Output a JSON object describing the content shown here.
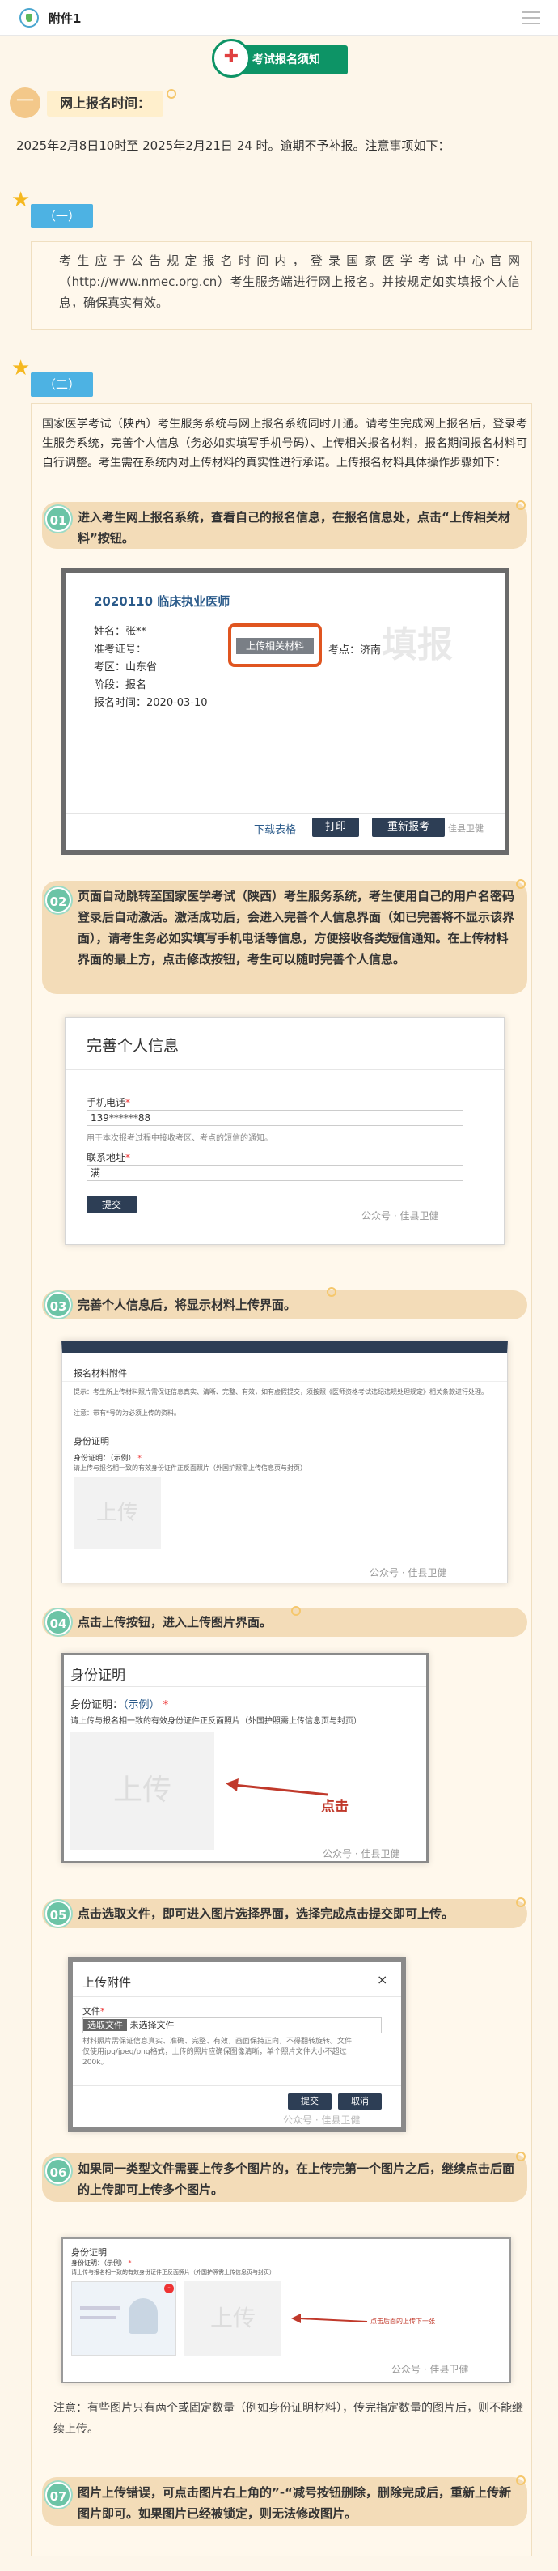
{
  "header": {
    "title": "附件1"
  },
  "banner": {
    "title": "考试报名须知"
  },
  "online_time": {
    "label": "网上报名时间：",
    "text": "2025年2月8日10时至 2025年2月21日 24 时。逾期不予补报。注意事项如下："
  },
  "section1": {
    "tag": "（一）",
    "text": "考生应于公告规定报名时间内，登录国家医学考试中心官网（http://www.nmec.org.cn）考生服务端进行网上报名。并按规定如实填报个人信息，确保真实有效。"
  },
  "section2": {
    "tag": "（二）",
    "text": "国家医学考试（陕西）考生服务系统与网上报名系统同时开通。请考生完成网上报名后，登录考生服务系统，完善个人信息（务必如实填写手机号码）、上传相关报名材料，报名期间报名材料可自行调整。考生需在系统内对上传材料的真实性进行承诺。上传报名材料具体操作步骤如下："
  },
  "steps": [
    {
      "num": "01",
      "text": "进入考生网上报名系统，查看自己的报名信息，在报名信息处，点击“上传相关材料”按钮。"
    },
    {
      "num": "02",
      "text": "页面自动跳转至国家医学考试（陕西）考生服务系统，考生使用自己的用户名密码登录后自动激活。激活成功后，会进入完善个人信息界面（如已完善将不显示该界面），请考生务必如实填写手机电话等信息，方便接收各类短信通知。在上传材料界面的最上方，点击修改按钮，考生可以随时完善个人信息。"
    },
    {
      "num": "03",
      "text": "完善个人信息后，将显示材料上传界面。"
    },
    {
      "num": "04",
      "text": "点击上传按钮，进入上传图片界面。"
    },
    {
      "num": "05",
      "text": "点击选取文件，即可进入图片选择界面，选择完成点击提交即可上传。"
    },
    {
      "num": "06",
      "text": "如果同一类型文件需要上传多个图片的，在上传完第一个图片之后，继续点击后面的上传即可上传多个图片。"
    },
    {
      "num": "07",
      "text": "图片上传错误，可点击图片右上角的”-“减号按钮删除，删除完成后，重新上传新图片即可。如果图片已经被锁定，则无法修改图片。"
    }
  ],
  "step6_note": "注意：有些图片只有两个或固定数量（例如身份证明材料），传完指定数量的图片后，则不能继续上传。",
  "shot1": {
    "title": "2020110 临床执业医师",
    "name_label": "姓名：",
    "name_value": "张**",
    "id_label": "准考证号：",
    "area_label": "考区：",
    "area_value": "山东省",
    "upload_btn": "上传相关材料",
    "kaodian_label": "考点：",
    "kaodian_value": "济南",
    "stage_label": "阶段：",
    "stage_value": "报名",
    "time_label": "报名时间：",
    "time_value": "2020-03-10",
    "stamp": "填报",
    "download": "下载表格",
    "print": "打印",
    "reapply": "重新报考",
    "watermark": "佳县卫健"
  },
  "shot2": {
    "title": "完善个人信息",
    "phone_label": "手机电话",
    "phone_value": "139******88",
    "phone_hint": "用于本次报考过程中接收考区、考点的短信的通知。",
    "addr_label": "联系地址",
    "addr_value": "满",
    "submit": "提交",
    "watermark": "公众号 · 佳县卫健"
  },
  "shot3": {
    "section": "报名材料附件",
    "hint": "提示：考生所上传材料照片需保证信息真实、清晰、完整、有效，如有虚假提交，须按照《医师资格考试违纪违规处理规定》相关条款进行处理。",
    "hint2": "注意：带有*号的为必须上传的资料。",
    "id_title": "身份证明",
    "id_label": "身份证明：（示例）",
    "id_desc": "请上传与报名相一致的有效身份证件正反面照片（外国护照需上传信息页与封页）",
    "upload": "上传",
    "watermark": "公众号 · 佳县卫健"
  },
  "shot4": {
    "title": "身份证明",
    "label": "身份证明：",
    "example": "（示例）",
    "desc": "请上传与报名相一致的有效身份证件正反面照片（外国护照需上传信息页与封页）",
    "upload": "上传",
    "click": "点击",
    "watermark": "公众号 · 佳县卫健"
  },
  "shot5": {
    "title": "上传附件",
    "file_label": "文件",
    "choose": "选取文件",
    "no_file": "未选择文件",
    "desc": "材料照片需保证信息真实、准确、完整、有效，画面保持正向，不得翻转旋转。文件仅使用jpg/jpeg/png格式，上传的照片应确保图像清晰，单个照片文件大小不超过200k。",
    "submit": "提交",
    "cancel": "取消",
    "watermark": "公众号 · 佳县卫健"
  },
  "shot6": {
    "title": "身份证明",
    "label": "身份证明：（示例）",
    "desc": "请上传与报名相一致的有效身份证件正反面照片（外国护照需上传信息页与封页）",
    "upload": "上传",
    "hint": "点击后面的上传下一张",
    "watermark": "公众号 · 佳县卫健"
  },
  "colors": {
    "accent": "#0d9466",
    "pill": "#4db2e3",
    "step": "#6bc4a6",
    "arrow": "#c0392b"
  }
}
